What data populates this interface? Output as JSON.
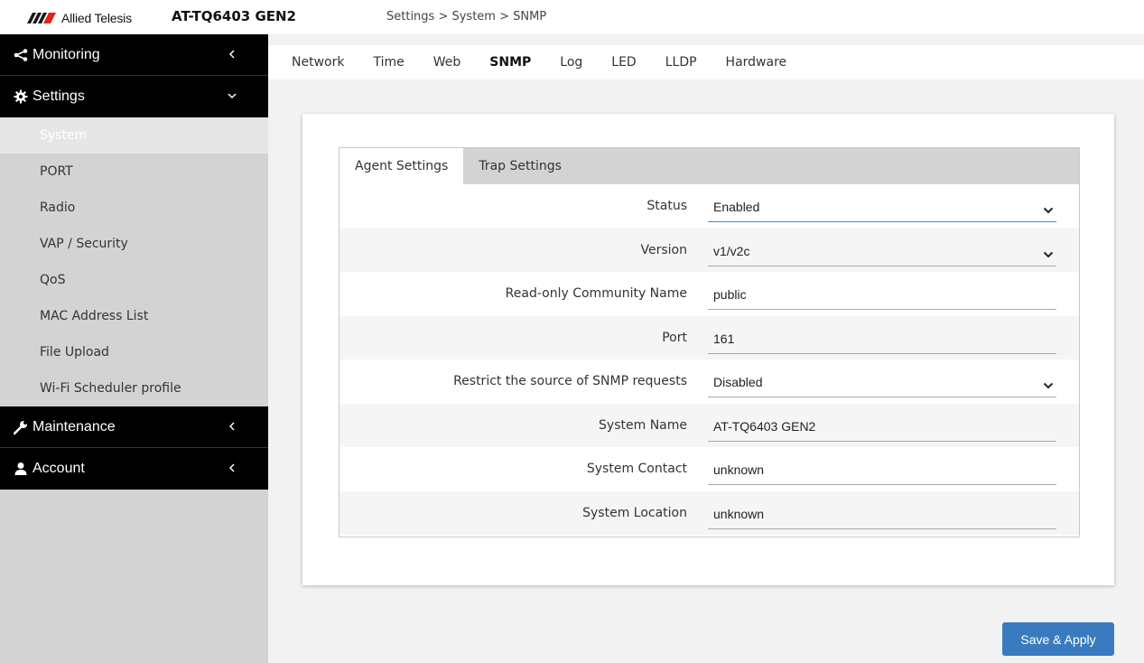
{
  "header": {
    "brand": "Allied Telesis",
    "model": "AT-TQ6403 GEN2",
    "breadcrumb": "Settings > System > SNMP"
  },
  "sidebar": {
    "monitoring": "Monitoring",
    "settings": "Settings",
    "settings_items": [
      "System",
      "PORT",
      "Radio",
      "VAP / Security",
      "QoS",
      "MAC Address List",
      "File Upload",
      "Wi-Fi Scheduler profile"
    ],
    "maintenance": "Maintenance",
    "account": "Account"
  },
  "tabs": [
    "Network",
    "Time",
    "Web",
    "SNMP",
    "Log",
    "LED",
    "LLDP",
    "Hardware"
  ],
  "subtabs": [
    "Agent Settings",
    "Trap Settings"
  ],
  "form": {
    "status_label": "Status",
    "status_value": "Enabled",
    "version_label": "Version",
    "version_value": "v1/v2c",
    "community_label": "Read-only Community Name",
    "community_value": "public",
    "port_label": "Port",
    "port_value": "161",
    "restrict_label": "Restrict the source of SNMP requests",
    "restrict_value": "Disabled",
    "sysname_label": "System Name",
    "sysname_value": "AT-TQ6403 GEN2",
    "contact_label": "System Contact",
    "contact_value": "unknown",
    "location_label": "System Location",
    "location_value": "unknown"
  },
  "save_label": "Save & Apply",
  "colors": {
    "accent": "#3a7bbf",
    "focus_underline": "#3a8fd6",
    "sidebar_bg": "#d3d3d3",
    "nav_group_bg": "#000000"
  }
}
